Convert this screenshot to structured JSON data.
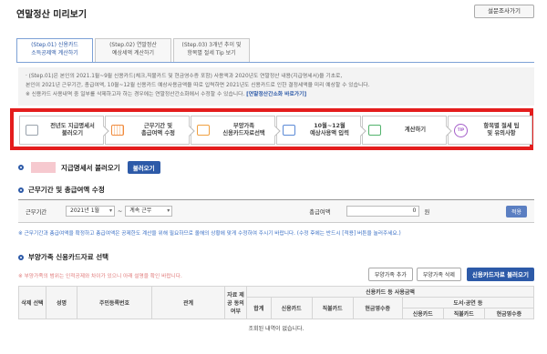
{
  "page": {
    "title": "연말정산 미리보기",
    "survey_button": "설문조사가기"
  },
  "tabs": [
    {
      "line1": "(Step.01) 신용카드",
      "line2": "소득공제액 계산하기",
      "active": true
    },
    {
      "line1": "(Step.02) 연말정산",
      "line2": "예상세액 계산하기",
      "active": false
    },
    {
      "line1": "(Step.03) 3개년 추이 및",
      "line2": "항목별 절세 Tip 보기",
      "active": false
    }
  ],
  "description": {
    "line1": "· (Step.01)은 본인의 2021.1월~9월 신용카드(체크,직불카드 및 현금영수증 포함) 사용액과 2020년도 연말정산 내용(지급명세서)을 기초로,",
    "line2": "본인이 2021년 근무기간, 총급여액, 10월~12월 신용카드 예상사용금액을 따로 입력하면 2021년도 신용카드로 인한 결정세액을 미리 예상할 수 있습니다.",
    "line3": "※ 신용카드 사용내역 중 일부를 삭제하고자 하는 경우에는 연말정산간소화에서 수정할 수 있습니다.",
    "link": "[연말정산간소화 바로가기]"
  },
  "steps": [
    {
      "label1": "전년도 지급명세서",
      "label2": "불러오기",
      "icon": "document-icon"
    },
    {
      "label1": "근무기간 및",
      "label2": "총급여액 수정",
      "icon": "calendar-icon"
    },
    {
      "label1": "부양가족",
      "label2": "신용카드자료선택",
      "icon": "monitor-icon"
    },
    {
      "label1": "10월~12월",
      "label2": "예상사용액 입력",
      "icon": "card-icon"
    },
    {
      "label1": "계산하기",
      "label2": "",
      "icon": "calculator-icon"
    },
    {
      "label1": "항목별 절세 팁",
      "label2": "및 유의사항",
      "icon": "tip-icon"
    }
  ],
  "tip_icon_text": "TIP",
  "section1": {
    "title": "지급명세서 불러오기",
    "button": "불러오기"
  },
  "section2": {
    "title": "근무기간 및 총급여액 수정",
    "period_label": "근무기간",
    "start_month": "2021년 1월",
    "separator": "~",
    "end_option": "계속 근무",
    "salary_label": "총급여액",
    "salary_value": "0",
    "unit": "원",
    "apply_button": "적용",
    "note": "※ 근무기간과 총급여액을 확정하고 총급여액은 공제한도 계산을 위해 필요하므로 올해의 상황에 맞게 수정하여 주시기 바랍니다. (수정 후에는 반드시 [적용] 버튼을 눌러주세요.)"
  },
  "section3": {
    "title": "부양가족 신용카드자료 선택",
    "note": "※ 부양가족의 범위는 인적공제와 차이가 있으니 아래 설명을 확인 바랍니다.",
    "add_button": "부양가족 추가",
    "delete_button": "부양가족 삭제",
    "load_button": "신용카드자료 불러오기"
  },
  "table": {
    "headers": {
      "delete_select": "삭제 선택",
      "name": "성명",
      "rrn": "주민등록번호",
      "relation": "관계",
      "data_query": "자료 제공 동의 여부",
      "card_usage": "신용카드 등 사용금액",
      "total": "합계",
      "credit": "신용카드",
      "debit": "직불카드",
      "cash": "현금영수증",
      "books": "도서·공연 등",
      "sub_credit": "신용카드",
      "sub_debit": "직불카드",
      "sub_cash": "현금영수증"
    },
    "empty_message": "조회된 내역이 없습니다."
  }
}
